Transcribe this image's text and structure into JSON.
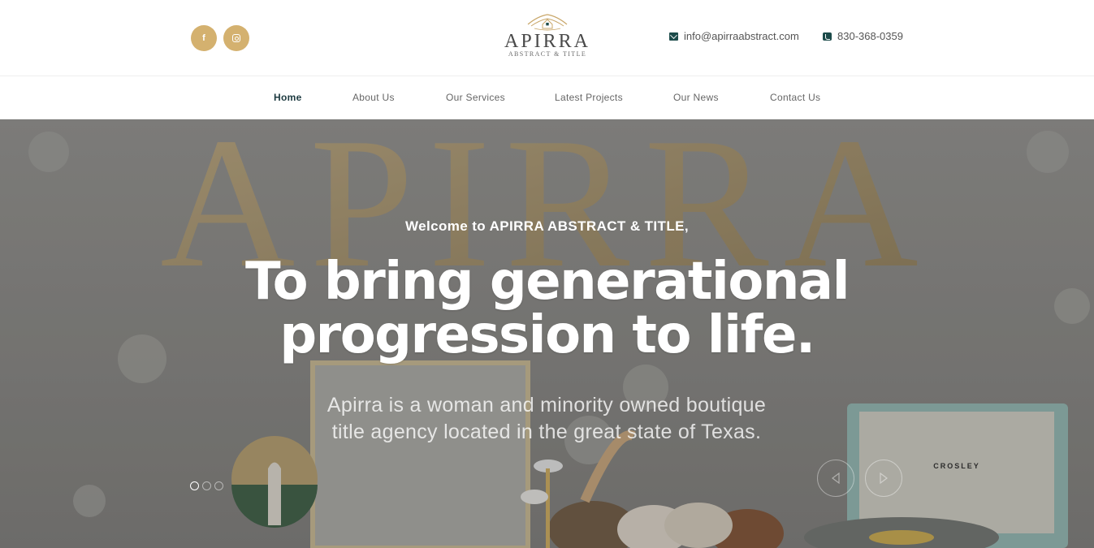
{
  "header": {
    "social": [
      {
        "name": "facebook-icon",
        "glyph": "f"
      },
      {
        "name": "instagram-icon",
        "glyph": ""
      }
    ],
    "logo": {
      "name": "APIRRA",
      "sub": "ABSTRACT & TITLE"
    },
    "email": "info@apirraabstract.com",
    "phone": "830-368-0359"
  },
  "nav": {
    "items": [
      {
        "label": "Home",
        "active": true
      },
      {
        "label": "About Us",
        "active": false
      },
      {
        "label": "Our Services",
        "active": false
      },
      {
        "label": "Latest Projects",
        "active": false
      },
      {
        "label": "Our News",
        "active": false
      },
      {
        "label": "Contact Us",
        "active": false
      }
    ]
  },
  "hero": {
    "welcome": "Welcome to APIRRA ABSTRACT & TITLE,",
    "headline_line1": "To bring generational",
    "headline_line2": "progression to life.",
    "subtext_line1": "Apirra is a woman and minority owned boutique",
    "subtext_line2": "title agency located in the great state of Texas.",
    "background_letters": "APIRRA",
    "record_player_brand": "CROSLEY",
    "slide_count": 3,
    "active_slide": 1
  },
  "colors": {
    "accent_gold": "#d4b16f",
    "dark_teal": "#1c4b4a",
    "nav_active": "#1d3a40"
  }
}
